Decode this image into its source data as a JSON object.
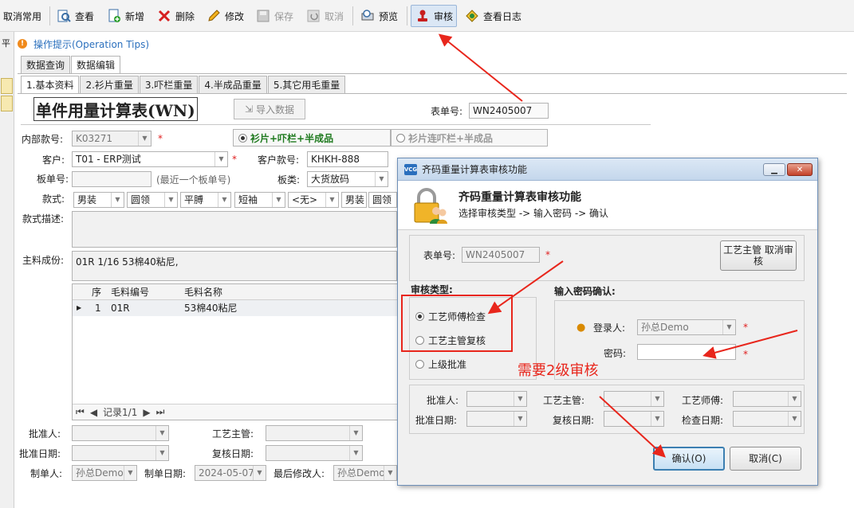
{
  "toolbar": {
    "items": [
      {
        "label": "取消常用",
        "icon": "unpin-icon"
      },
      {
        "label": "查看",
        "icon": "view-icon"
      },
      {
        "label": "新增",
        "icon": "add-icon"
      },
      {
        "label": "删除",
        "icon": "delete-icon"
      },
      {
        "label": "修改",
        "icon": "edit-icon"
      },
      {
        "label": "保存",
        "icon": "save-icon"
      },
      {
        "label": "取消",
        "icon": "undo-icon"
      },
      {
        "label": "预览",
        "icon": "preview-icon"
      },
      {
        "label": "审核",
        "icon": "audit-stamp-icon"
      },
      {
        "label": "查看日志",
        "icon": "log-icon"
      }
    ]
  },
  "left_strip_char": "平",
  "tips": "操作提示(Operation Tips)",
  "tabs_top": [
    "数据查询",
    "数据编辑"
  ],
  "tabs_sub": [
    "1.基本资料",
    "2.衫片重量",
    "3.吓栏重量",
    "4.半成品重量",
    "5.其它用毛重量"
  ],
  "form": {
    "title": "单件用量计算表(WN)",
    "import_button": "导入数据",
    "order_no_label": "表单号:",
    "order_no": "WN2405007",
    "internal_style_label": "内部款号:",
    "internal_style": "K03271",
    "radio_option1": "衫片+吓栏+半成品",
    "radio_option2": "衫片连吓栏+半成品",
    "customer_label": "客户:",
    "customer": "T01 - ERP测试",
    "customer_style_label": "客户款号:",
    "customer_style": "KHKH-888",
    "board_no_label": "板单号:",
    "board_no_hint": "(最近一个板单号)",
    "board_type_label": "板类:",
    "board_type": "大货放码",
    "style_label": "款式:",
    "style_values": [
      "男装",
      "圆领",
      "平膊",
      "短袖",
      "<无>",
      "男装",
      "圆领"
    ],
    "style_desc_label": "款式描述:",
    "main_material_label": "主料成份:",
    "main_material": "01R 1/16 53棉40粘尼,",
    "grid_headers": {
      "seq": "序",
      "code": "毛料编号",
      "name": "毛料名称"
    },
    "grid_row": {
      "seq": "1",
      "code": "01R",
      "name": "53棉40粘尼"
    },
    "grid_nav": "记录1/1",
    "approver_label": "批准人:",
    "process_supervisor_label": "工艺主管:",
    "approve_date_label": "批准日期:",
    "recheck_date_label": "复核日期:",
    "creator_label": "制单人:",
    "creator": "孙总Demo",
    "create_date_label": "制单日期:",
    "create_date": "2024-05-07",
    "last_modifier_label": "最后修改人:",
    "last_modifier": "孙总Demo"
  },
  "dialog": {
    "title": "齐码重量计算表审核功能",
    "heading": "齐码重量计算表审核功能",
    "subheading": "选择审核类型 -> 输入密码 -> 确认",
    "order_no_label": "表单号:",
    "order_no": "WN2405007",
    "cancel_audit_button": "工艺主管 取消审核",
    "audit_type_label": "审核类型:",
    "audit_types": [
      "工艺师傅检查",
      "工艺主管复核",
      "上级批准"
    ],
    "password_section_label": "输入密码确认:",
    "login_user_label": "登录人:",
    "login_user": "孙总Demo",
    "password_label": "密码:",
    "approver_label": "批准人:",
    "process_supervisor_label": "工艺主管:",
    "process_master_label": "工艺师傅:",
    "approve_date_label": "批准日期:",
    "recheck_date_label": "复核日期:",
    "check_date_label": "检查日期:",
    "confirm_button": "确认(O)",
    "cancel_button": "取消(C)"
  },
  "annotation": "需要2级审核",
  "colors": {
    "annotation_red": "#e8261c",
    "tips_blue": "#2a6fbd",
    "dialog_border": "#6d8fb8"
  }
}
